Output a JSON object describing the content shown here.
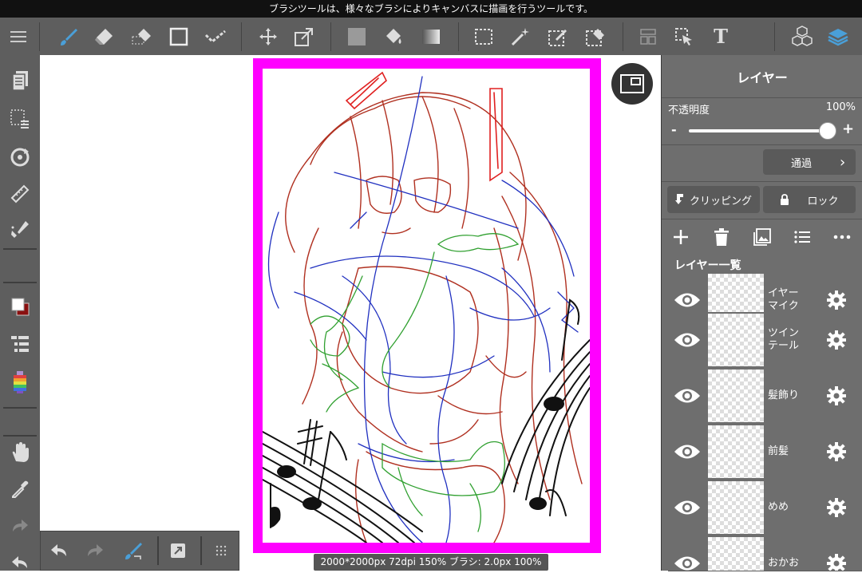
{
  "tooltip": "ブラシツールは、様々なブラシによりキャンバスに描画を行うツールです。",
  "toolbar": {
    "icons": [
      "menu-icon",
      "brush-icon",
      "eraser-icon",
      "blur-eraser-icon",
      "rectangle-icon",
      "correction-icon",
      "move-icon",
      "transform-icon",
      "fill-rect-icon",
      "bucket-icon",
      "gradient-icon",
      "select-icon",
      "magic-wand-icon",
      "select-pen-icon",
      "select-eraser-icon",
      "snap-icon",
      "operation-icon",
      "text-icon",
      "3d-model-icon",
      "layers-icon"
    ],
    "text_tool": "T"
  },
  "sidebar": {
    "icons": [
      "pages-icon",
      "selection-icon",
      "rotate-icon",
      "ruler-icon",
      "fill-pen-icon",
      "color-swatch-icon",
      "layer-tree-icon",
      "color-palette-icon",
      "hand-icon",
      "eyedropper-icon",
      "redo-icon",
      "undo-icon"
    ],
    "colors": {
      "main": "#ffffff",
      "sub": "#8a1010"
    }
  },
  "bottom_tools": {
    "icons": [
      "undo-icon",
      "redo-icon",
      "brush-toggle-icon",
      "expand-icon",
      "grid-icon"
    ]
  },
  "status": "2000*2000px 72dpi 150% ブラシ: 2.0px 100%",
  "layer_panel": {
    "title": "レイヤー",
    "opacity_label": "不透明度",
    "opacity_value": "100%",
    "opacity_fraction": 1.0,
    "slider_minus": "-",
    "slider_plus": "+",
    "blend_mode": "通過",
    "clipping_label": "クリッピング",
    "lock_label": "ロック",
    "list_title": "レイヤー一覧",
    "layers": [
      {
        "name": "イヤー\nマイク"
      },
      {
        "name": "ツイン\nテール"
      },
      {
        "name": "髪飾り"
      },
      {
        "name": "前髪"
      },
      {
        "name": "めめ"
      },
      {
        "name": "おかお"
      }
    ]
  },
  "colors": {
    "frame": "#ff00ff",
    "ui_dark": "#5e5e5e",
    "accent_blue": "#4a9fd8",
    "line_red": "#b03020",
    "line_blue": "#2030c0",
    "line_green": "#30a030"
  }
}
